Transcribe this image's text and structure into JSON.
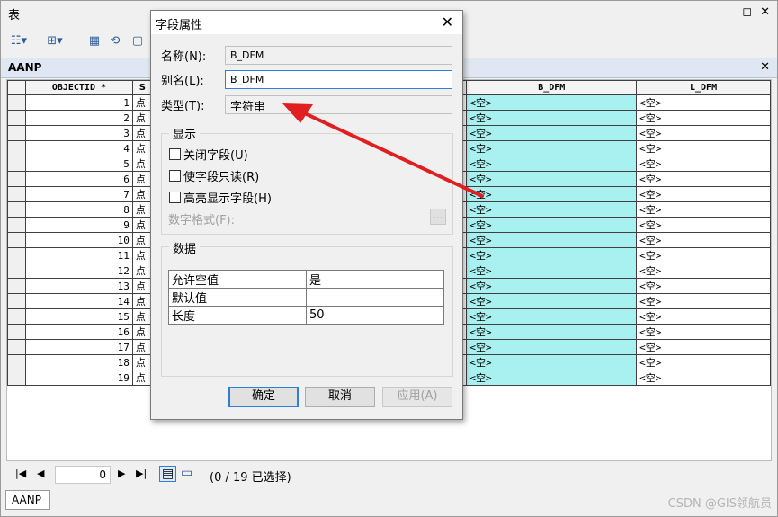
{
  "window": {
    "title": "表"
  },
  "toolbar": {
    "icons": [
      "table-options-icon",
      "related-tables-icon",
      "select-by-attributes-icon",
      "switch-selection-icon",
      "clear-selection-icon"
    ]
  },
  "table_tab": {
    "label": "AANP"
  },
  "grid": {
    "columns": [
      "OBJECTID *",
      "S",
      "B_DFM",
      "L_DFM"
    ],
    "rows": [
      {
        "id": "1",
        "shape": "点",
        "b": "<空>",
        "l": "<空>"
      },
      {
        "id": "2",
        "shape": "点",
        "b": "<空>",
        "l": "<空>"
      },
      {
        "id": "3",
        "shape": "点",
        "b": "<空>",
        "l": "<空>"
      },
      {
        "id": "4",
        "shape": "点",
        "b": "<空>",
        "l": "<空>"
      },
      {
        "id": "5",
        "shape": "点",
        "b": "<空>",
        "l": "<空>"
      },
      {
        "id": "6",
        "shape": "点",
        "b": "<空>",
        "l": "<空>"
      },
      {
        "id": "7",
        "shape": "点",
        "b": "<空>",
        "l": "<空>"
      },
      {
        "id": "8",
        "shape": "点",
        "b": "<空>",
        "l": "<空>"
      },
      {
        "id": "9",
        "shape": "点",
        "b": "<空>",
        "l": "<空>"
      },
      {
        "id": "10",
        "shape": "点",
        "b": "<空>",
        "l": "<空>"
      },
      {
        "id": "11",
        "shape": "点",
        "b": "<空>",
        "l": "<空>"
      },
      {
        "id": "12",
        "shape": "点",
        "b": "<空>",
        "l": "<空>"
      },
      {
        "id": "13",
        "shape": "点",
        "b": "<空>",
        "l": "<空>"
      },
      {
        "id": "14",
        "shape": "点",
        "b": "<空>",
        "l": "<空>"
      },
      {
        "id": "15",
        "shape": "点",
        "b": "<空>",
        "l": "<空>"
      },
      {
        "id": "16",
        "shape": "点",
        "b": "<空>",
        "l": "<空>"
      },
      {
        "id": "17",
        "shape": "点",
        "b": "<空>",
        "l": "<空>"
      },
      {
        "id": "18",
        "shape": "点",
        "b": "<空>",
        "l": "<空>"
      },
      {
        "id": "19",
        "shape": "点",
        "b": "<空>",
        "l": "<空>"
      }
    ]
  },
  "navigator": {
    "record": "0",
    "selection": "(0 / 19 已选择)"
  },
  "bottom_tab": "AANP",
  "watermark": "CSDN @GIS领航员",
  "dialog": {
    "title": "字段属性",
    "name_label": "名称(N):",
    "name_value": "B_DFM",
    "alias_label": "别名(L):",
    "alias_value": "B_DFM",
    "type_label": "类型(T):",
    "type_value": "字符串",
    "display_group": "显示",
    "chk_close": "关闭字段(U)",
    "chk_readonly": "使字段只读(R)",
    "chk_highlight": "高亮显示字段(H)",
    "number_format": "数字格式(F):",
    "number_format_button": "...",
    "data_group": "数据",
    "props": [
      {
        "key": "允许空值",
        "value": "是"
      },
      {
        "key": "默认值",
        "value": ""
      },
      {
        "key": "长度",
        "value": "50"
      }
    ],
    "ok": "确定",
    "cancel": "取消",
    "apply": "应用(A)"
  },
  "colors": {
    "highlight_column": "#a9f1f1",
    "arrow": "#e02020",
    "focus": "#2f7fd8"
  }
}
